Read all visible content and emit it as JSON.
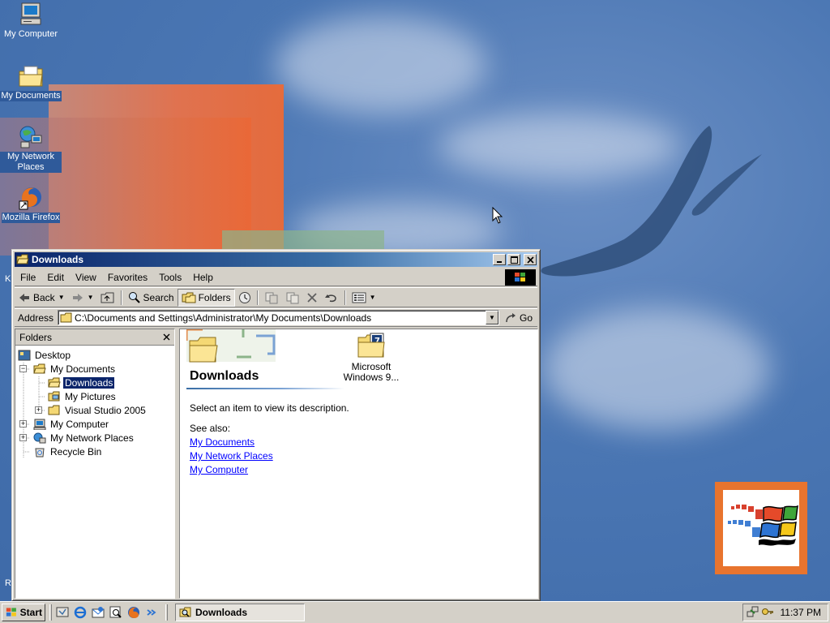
{
  "desktop": {
    "icons": [
      {
        "label": "My Computer",
        "icon": "my-computer-icon"
      },
      {
        "label": "My Documents",
        "icon": "my-documents-icon"
      },
      {
        "label": "My Network Places",
        "icon": "network-places-icon"
      },
      {
        "label": "Mozilla Firefox",
        "icon": "firefox-icon"
      }
    ],
    "edge_letters": {
      "k": "K",
      "r": "R"
    }
  },
  "window": {
    "title": "Downloads",
    "menu": [
      "File",
      "Edit",
      "View",
      "Favorites",
      "Tools",
      "Help"
    ],
    "toolbar": {
      "back": "Back",
      "search": "Search",
      "folders": "Folders"
    },
    "address": {
      "label": "Address",
      "value": "C:\\Documents and Settings\\Administrator\\My Documents\\Downloads",
      "go": "Go"
    },
    "folders_pane": {
      "title": "Folders",
      "tree": [
        {
          "label": "Desktop",
          "level": 0,
          "expander": ""
        },
        {
          "label": "My Documents",
          "level": 1,
          "expander": "−"
        },
        {
          "label": "Downloads",
          "level": 2,
          "expander": "",
          "selected": true
        },
        {
          "label": "My Pictures",
          "level": 2,
          "expander": ""
        },
        {
          "label": "Visual Studio 2005",
          "level": 2,
          "expander": "+"
        },
        {
          "label": "My Computer",
          "level": 1,
          "expander": "+"
        },
        {
          "label": "My Network Places",
          "level": 1,
          "expander": "+"
        },
        {
          "label": "Recycle Bin",
          "level": 1,
          "expander": ""
        }
      ]
    },
    "content": {
      "heading": "Downloads",
      "description": "Select an item to view its description.",
      "see_also": "See also:",
      "links": [
        "My Documents",
        "My Network Places",
        "My Computer"
      ],
      "files": [
        {
          "name_line1": "Microsoft",
          "name_line2": "Windows 9..."
        }
      ]
    }
  },
  "taskbar": {
    "start": "Start",
    "tasks": [
      {
        "label": "Downloads"
      }
    ],
    "clock": "11:37 PM"
  },
  "colors": {
    "titlebar_active": "#0a246a",
    "selection": "#0a246a",
    "link": "#0000ff",
    "face": "#d4d0c8"
  }
}
